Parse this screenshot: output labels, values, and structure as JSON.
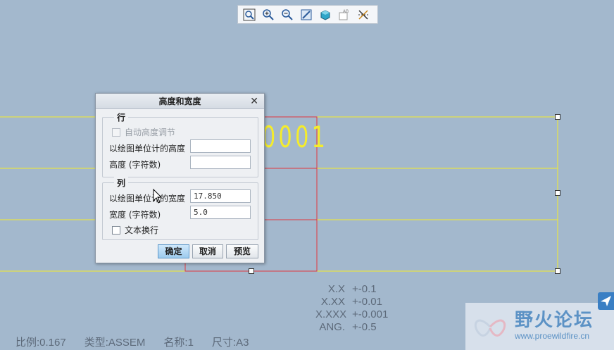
{
  "toolbar": {
    "buttons": [
      {
        "icon": "zoom-fit-icon"
      },
      {
        "icon": "zoom-in-icon"
      },
      {
        "icon": "zoom-out-icon"
      },
      {
        "icon": "repaint-icon"
      },
      {
        "icon": "display-style-icon"
      },
      {
        "icon": "annotation-display-icon"
      },
      {
        "icon": "datum-display-icon"
      }
    ]
  },
  "drawing": {
    "table_text": "0001",
    "tolerances": [
      {
        "key": "X.X",
        "value": "+-0.1"
      },
      {
        "key": "X.XX",
        "value": "+-0.01"
      },
      {
        "key": "X.XXX",
        "value": "+-0.001"
      },
      {
        "key": "ANG.",
        "value": "+-0.5"
      }
    ],
    "status": {
      "scale": "比例:0.167",
      "type": "类型:ASSEM",
      "name": "名称:1",
      "size": "尺寸:A3"
    },
    "colors": {
      "background": "#a3b8cd",
      "table_lines": "#f4ec2c",
      "selection": "#e0383e"
    }
  },
  "dialog": {
    "title": "高度和宽度",
    "close": "✕",
    "rows_group": {
      "title": "行",
      "auto_height_label": "自动高度调节",
      "height_drawing_units_label": "以绘图单位计的高度",
      "height_drawing_units_value": "",
      "height_chars_label": "高度 (字符数)",
      "height_chars_value": ""
    },
    "columns_group": {
      "title": "列",
      "width_drawing_units_label": "以绘图单位计的宽度",
      "width_drawing_units_value": "17.850",
      "width_chars_label": "宽度 (字符数)",
      "width_chars_value": "5.0",
      "text_wrap_label": "文本换行"
    },
    "buttons": {
      "ok": "确定",
      "cancel": "取消",
      "preview": "预览"
    }
  },
  "watermark": {
    "title": "野火论坛",
    "url": "www.proewildfire.cn"
  }
}
